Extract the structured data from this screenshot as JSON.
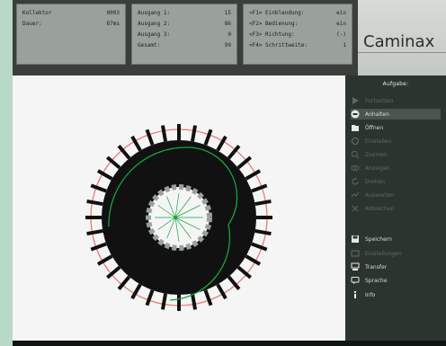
{
  "header": {
    "panel1": {
      "rows": [
        {
          "label": "Kollektor",
          "value": "0003"
        },
        {
          "label": "Dauer:",
          "value": "87ms"
        }
      ]
    },
    "panel2": {
      "rows": [
        {
          "label": "Ausgang 1:",
          "value": "15"
        },
        {
          "label": "Ausgang 2:",
          "value": "86"
        },
        {
          "label": "Ausgang 3:",
          "value": "0"
        },
        {
          "label": "Gesamt:",
          "value": "99"
        }
      ]
    },
    "panel3": {
      "rows": [
        {
          "label": "<F1> Einblendung:",
          "value": "ein"
        },
        {
          "label": "<F2> Bedienung:",
          "value": "ein"
        },
        {
          "label": "<F3> Richtung:",
          "value": "(-)"
        },
        {
          "label": "<F4> Schrittweite:",
          "value": "1"
        }
      ]
    },
    "logo": "Caminax"
  },
  "sidebar": {
    "section_title": "Aufgabe:",
    "items": [
      {
        "label": "Fortsetzen",
        "icon": "play-icon",
        "state": "disabled"
      },
      {
        "label": "Anhalten",
        "icon": "stop-icon",
        "state": "selected"
      },
      {
        "label": "Öffnen",
        "icon": "folder-open-icon",
        "state": "enabled"
      },
      {
        "label": "Einstellen",
        "icon": "settings-icon",
        "state": "disabled"
      },
      {
        "label": "Zoomen",
        "icon": "zoom-icon",
        "state": "disabled"
      },
      {
        "label": "Anzeigen",
        "icon": "view-icon",
        "state": "disabled"
      },
      {
        "label": "Drehen",
        "icon": "rotate-icon",
        "state": "disabled"
      },
      {
        "label": "Auswerten",
        "icon": "evaluate-icon",
        "state": "disabled"
      },
      {
        "label": "Abbrechen",
        "icon": "cancel-icon",
        "state": "disabled"
      },
      {
        "label": "Speichern",
        "icon": "save-icon",
        "state": "enabled"
      },
      {
        "label": "Einstellungen",
        "icon": "options-icon",
        "state": "disabled"
      },
      {
        "label": "Transfer",
        "icon": "transfer-icon",
        "state": "enabled"
      },
      {
        "label": "Sprache",
        "icon": "language-icon",
        "state": "enabled"
      },
      {
        "label": "Info",
        "icon": "info-icon",
        "state": "enabled"
      }
    ]
  },
  "colors": {
    "app_bg": "#1e2a26",
    "header_panel": "#9aa19d",
    "canvas": "#f4f5f4",
    "sidebar": "#2c3430",
    "gear": "#111111",
    "guide_red": "#e97a7a",
    "guide_green": "#19a43f",
    "inner_ring": "#9aa19d"
  }
}
